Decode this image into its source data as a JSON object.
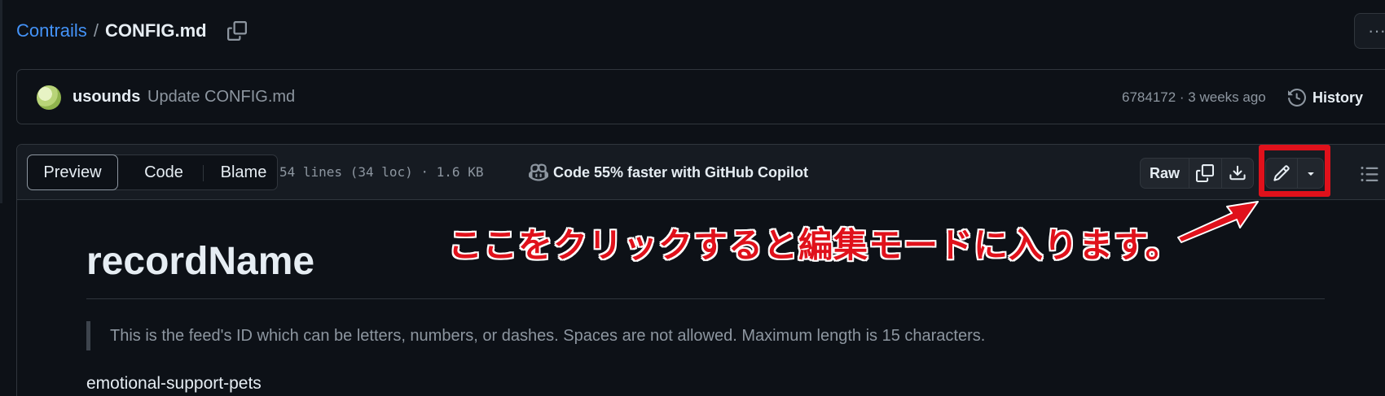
{
  "breadcrumb": {
    "repo": "Contrails",
    "separator": "/",
    "file": "CONFIG.md"
  },
  "commit": {
    "author": "usounds",
    "message": "Update CONFIG.md",
    "meta": "6784172 · 3 weeks ago",
    "history_label": "History"
  },
  "toolbar": {
    "tabs": [
      "Preview",
      "Code",
      "Blame"
    ],
    "active_tab": "Preview",
    "file_meta": "54 lines (34 loc) · 1.6 KB",
    "copilot_text": "Code 55% faster with GitHub Copilot",
    "raw_label": "Raw"
  },
  "content": {
    "heading": "recordName",
    "quote": "This is the feed's ID which can be letters, numbers, or dashes. Spaces are not allowed. Maximum length is 15 characters.",
    "value": "emotional-support-pets"
  },
  "annotation": {
    "text": "ここをクリックすると編集モードに入ります。",
    "color": "#e0111b"
  },
  "icons": {
    "copy_path": "copy-icon",
    "more": "kebab-horizontal-icon",
    "history": "history-icon",
    "copilot": "copilot-icon",
    "copy_raw": "copy-icon",
    "download": "download-icon",
    "edit": "pencil-icon",
    "dropdown": "triangle-down-icon",
    "outline": "list-unordered-icon"
  },
  "colors": {
    "link": "#4493f8",
    "background": "#0d1117",
    "border": "#30363d",
    "muted": "#8d96a0"
  }
}
